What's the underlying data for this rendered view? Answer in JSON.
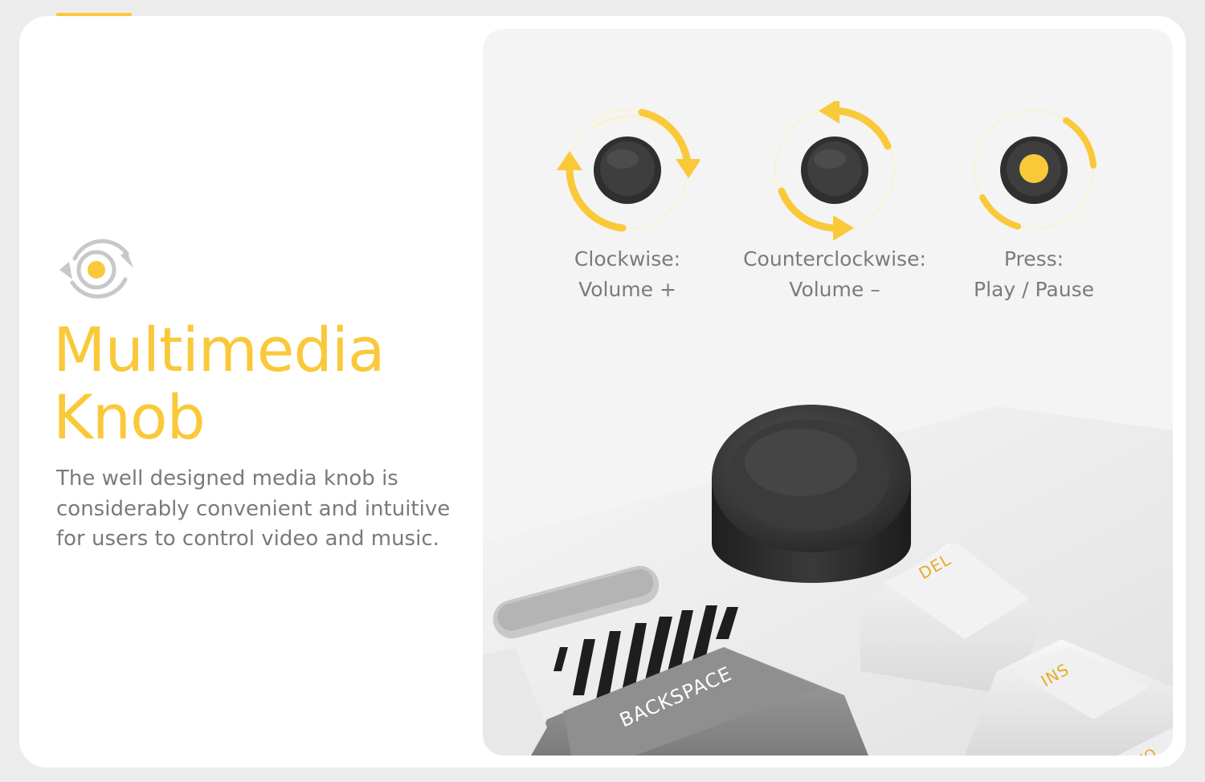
{
  "colors": {
    "accent": "#f9c93a",
    "text_gray": "#7a7a7a",
    "knob_dark": "#2e2e2e"
  },
  "feature": {
    "icon": "rotate-knob-icon",
    "title_line1": "Multimedia",
    "title_line2": "Knob",
    "description_line1": "The well designed media knob is",
    "description_line2": "considerably convenient and intuitive",
    "description_line3": "for users to control video and music."
  },
  "actions": [
    {
      "icon": "clockwise-rotate-icon",
      "label": "Clockwise:",
      "function": "Volume +"
    },
    {
      "icon": "counterclockwise-rotate-icon",
      "label": "Counterclockwise:",
      "function": "Volume –"
    },
    {
      "icon": "press-knob-icon",
      "label": "Press:",
      "function": "Play / Pause"
    }
  ],
  "keyboard": {
    "keys": [
      "DEL",
      "INS",
      "BACKSPACE",
      "HO"
    ]
  }
}
